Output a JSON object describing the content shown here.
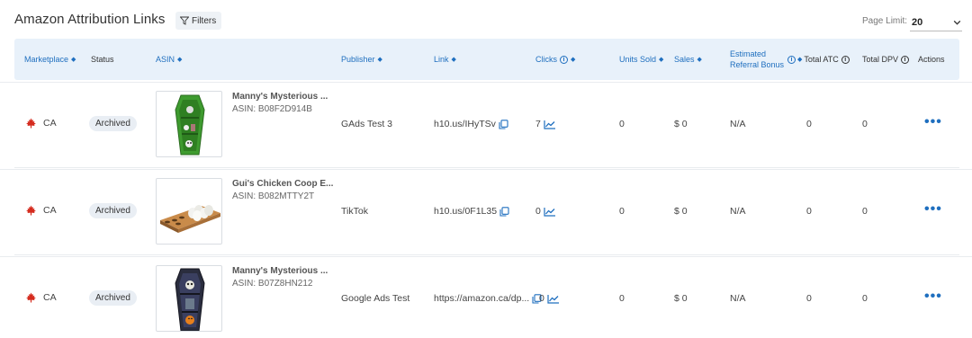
{
  "header": {
    "title": "Amazon Attribution Links",
    "filters_label": "Filters",
    "page_limit_label": "Page Limit:",
    "page_limit_value": "20"
  },
  "columns": {
    "marketplace": "Marketplace",
    "status": "Status",
    "asin": "ASIN",
    "publisher": "Publisher",
    "link": "Link",
    "clicks": "Clicks",
    "units_sold": "Units Sold",
    "sales": "Sales",
    "estimated_line1": "Estimated",
    "estimated_line2": "Referral Bonus",
    "total_atc": "Total ATC",
    "total_dpv": "Total DPV",
    "actions": "Actions"
  },
  "rows": [
    {
      "marketplace": "CA",
      "status": "Archived",
      "product_name": "Manny's Mysterious ...",
      "asin": "ASIN: B08F2D914B",
      "publisher": "GAds Test 3",
      "link": "h10.us/IHyTSv",
      "clicks": "7",
      "units_sold": "0",
      "sales": "$ 0",
      "referral_bonus": "N/A",
      "total_atc": "0",
      "total_dpv": "0",
      "actions": "•••"
    },
    {
      "marketplace": "CA",
      "status": "Archived",
      "product_name": "Gui's Chicken Coop E...",
      "asin": "ASIN: B082MTTY2T",
      "publisher": "TikTok",
      "link": "h10.us/0F1L35",
      "clicks": "0",
      "units_sold": "0",
      "sales": "$ 0",
      "referral_bonus": "N/A",
      "total_atc": "0",
      "total_dpv": "0",
      "actions": "•••"
    },
    {
      "marketplace": "CA",
      "status": "Archived",
      "product_name": "Manny's Mysterious ...",
      "asin": "ASIN: B07Z8HN212",
      "publisher": "Google Ads Test",
      "link": "https://amazon.ca/dp...",
      "clicks": "0",
      "units_sold": "0",
      "sales": "$ 0",
      "referral_bonus": "N/A",
      "total_atc": "0",
      "total_dpv": "0",
      "actions": "•••"
    }
  ],
  "icons": {
    "filter": "filter-icon",
    "chevron": "chevron-down-icon",
    "flag": "canada-flag-icon",
    "copy": "copy-icon",
    "trend": "trend-chart-icon",
    "info": "info-icon",
    "sort": "sort-icon"
  },
  "colors": {
    "accent": "#1f6fbf",
    "header_bg": "#e8f1fa",
    "badge_bg": "#e9eef4",
    "flag_red": "#d52b1e"
  }
}
